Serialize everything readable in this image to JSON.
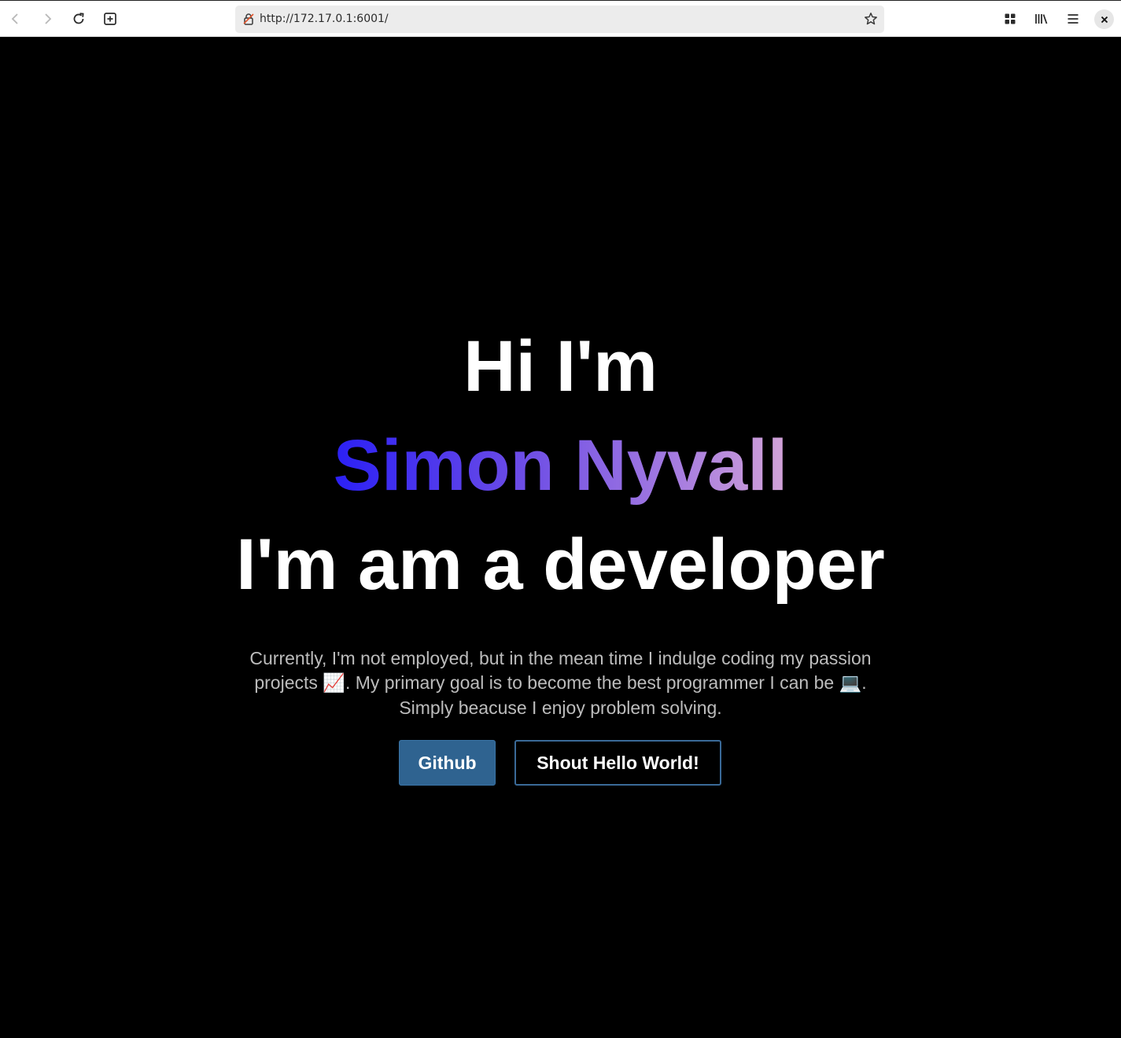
{
  "browser": {
    "url": "http://172.17.0.1:6001/",
    "icons": {
      "back": "back-arrow-icon",
      "forward": "forward-arrow-icon",
      "reload": "reload-icon",
      "new_tab": "new-tab-icon",
      "lock": "insecure-lock-icon",
      "bookmark": "star-icon",
      "apps": "grid-icon",
      "library": "library-icon",
      "menu": "hamburger-menu-icon",
      "close": "close-icon"
    }
  },
  "hero": {
    "greeting": "Hi I'm",
    "name": "Simon Nyvall",
    "tagline": "I'm am a developer",
    "intro": {
      "part1": "Currently, I'm not employed, but in the mean time I indulge coding my passion projects ",
      "emoji1": "📈",
      "part2": ". My primary goal is to become the best programmer I can be ",
      "emoji2": "💻",
      "part3": ". Simply beacuse I enjoy problem solving."
    },
    "buttons": {
      "github": "Github",
      "shout": "Shout Hello World!"
    }
  },
  "colors": {
    "background": "#000000",
    "name_gradient_start": "#2b20f5",
    "name_gradient_end": "#d2a3d8",
    "github_button": "#2f6390",
    "shout_border": "#3a6a98"
  }
}
